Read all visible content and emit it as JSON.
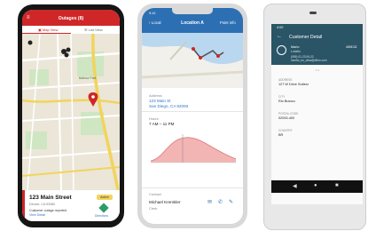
{
  "phone1": {
    "title": "Outages (8)",
    "tab_map": "Map View",
    "tab_list": "List View",
    "place_label": "Balboa Park",
    "card_title": "123 Main Street",
    "card_badge": "Active",
    "card_city": "Denver, CA 92080",
    "card_line1": "Customer outage reported",
    "card_line2": "View Detail",
    "card_action": "Directions",
    "accent_color": "#cf2727"
  },
  "phone2": {
    "time": "9:41",
    "back_label": "Local",
    "title": "Location A",
    "action_label": "Point Info",
    "address_label": "Address",
    "address_line1": "123 Main St",
    "address_line2": "San Diego, CA 92093",
    "hours_label": "Hours",
    "hours_value": "7 AM – 11 PM",
    "contact_label": "Contact",
    "contact_name": "Michael Kremkler",
    "contact_role": "Clerk",
    "accent_color": "#2d6fb3"
  },
  "phone3": {
    "time": "4:00",
    "title": "Customer Detail",
    "customer_name": "Mario",
    "customer_surname": "Lobello",
    "phone": "(555) 01-23-94-22",
    "email": "lunetto_bo_ufisa@dfirm.com",
    "status_text": "4008132",
    "address_label": "ADDRESS",
    "address_value": "127 W Drive Sutterz",
    "city_label": "CITY",
    "city_value": "Rio Branco",
    "postal_label": "POSTAL CODE",
    "postal_value": "02000-400",
    "country_label": "COUNTRY",
    "country_value": "BR",
    "accent_color": "#2a5566"
  }
}
